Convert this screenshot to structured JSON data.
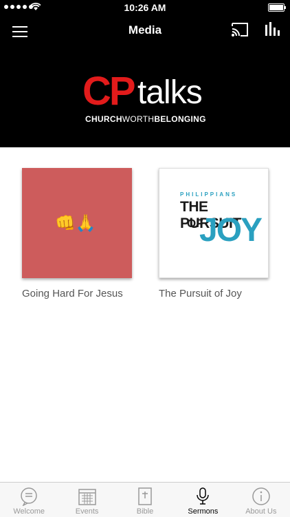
{
  "status": {
    "time": "10:26 AM"
  },
  "navbar": {
    "title": "Media"
  },
  "banner": {
    "logo_cp": "CP",
    "logo_talks": "talks",
    "tag_part1": "CHURCH",
    "tag_part2": "WORTH",
    "tag_part3": "BELONGING"
  },
  "media": [
    {
      "title": "Going Hard For Jesus",
      "thumb_emoji": "👊🙏"
    },
    {
      "title": "The Pursuit of Joy",
      "cover_small": "PHILIPPIANS",
      "cover_line1": "THE PURSUIT",
      "cover_line2": "OF",
      "cover_line3": "JOY"
    }
  ],
  "tabs": [
    {
      "label": "Welcome",
      "icon": "chat-bubble-icon",
      "active": false
    },
    {
      "label": "Events",
      "icon": "calendar-icon",
      "active": false
    },
    {
      "label": "Bible",
      "icon": "bible-icon",
      "active": false
    },
    {
      "label": "Sermons",
      "icon": "microphone-icon",
      "active": true
    },
    {
      "label": "About Us",
      "icon": "info-icon",
      "active": false
    }
  ]
}
